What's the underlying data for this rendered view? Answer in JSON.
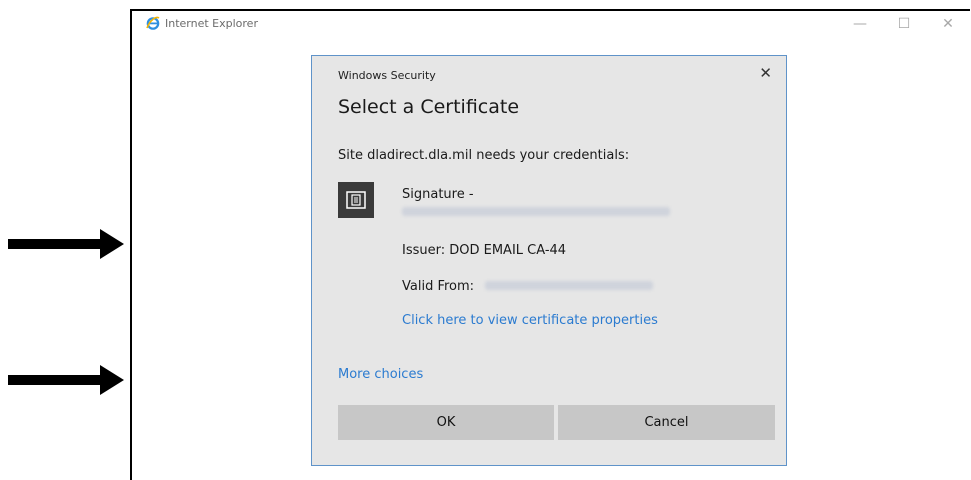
{
  "browser": {
    "title": "Internet Explorer",
    "controls": {
      "minimize": "—",
      "maximize": "☐",
      "close": "✕"
    }
  },
  "dialog": {
    "caption": "Windows Security",
    "close_glyph": "✕",
    "heading": "Select a Certificate",
    "prompt": "Site dladirect.dla.mil needs your credentials:",
    "certificate": {
      "icon": "certificate-icon",
      "name": "Signature -",
      "issuer": "Issuer: DOD EMAIL CA-44",
      "valid_from_label": "Valid From:",
      "view_properties_link": "Click here to view certificate properties"
    },
    "more_choices": "More choices",
    "ok_label": "OK",
    "cancel_label": "Cancel"
  },
  "colors": {
    "link": "#2b7bd0",
    "dialog_bg": "#e6e6e6",
    "dialog_border": "#5f93c9",
    "button_bg": "#c7c7c7",
    "icon_bg": "#3a3a3a",
    "annotation_arrow": "#000000"
  }
}
